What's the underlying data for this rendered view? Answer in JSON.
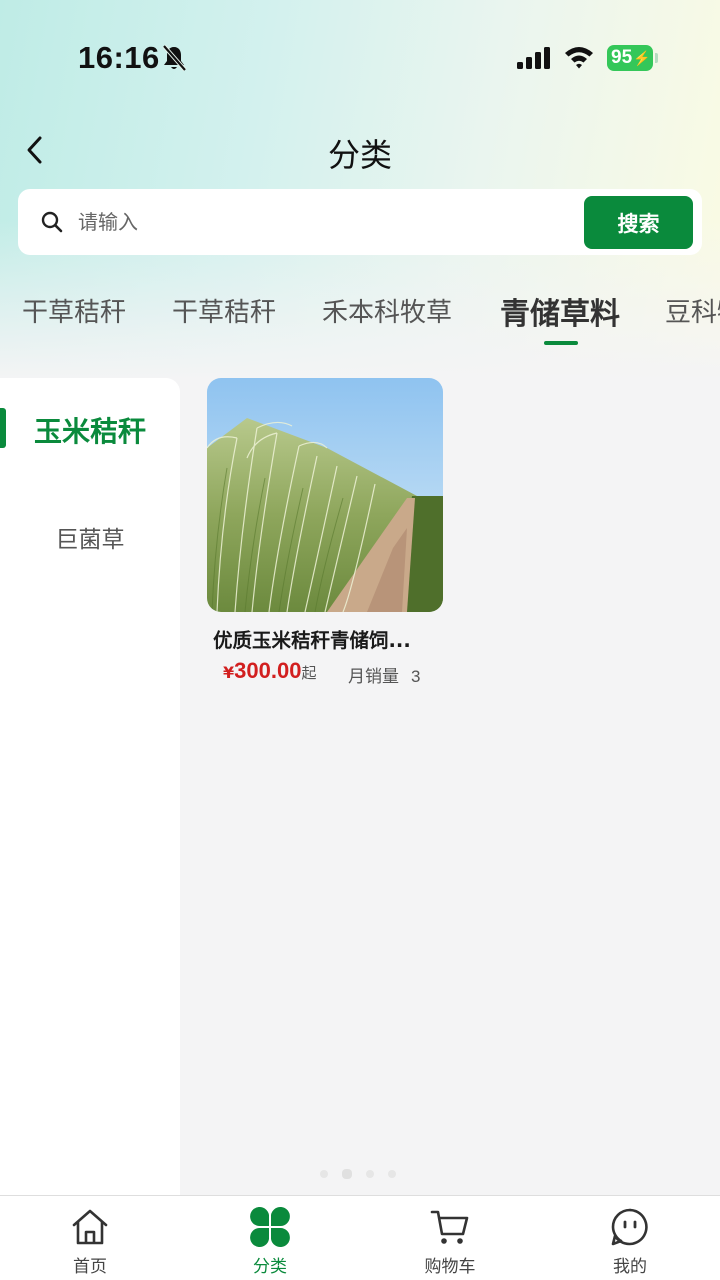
{
  "status_bar": {
    "time": "16:16",
    "battery": "95"
  },
  "header": {
    "title": "分类"
  },
  "search": {
    "placeholder": "请输入",
    "button_label": "搜索"
  },
  "category_tabs": [
    {
      "label": "干草秸秆",
      "active": false
    },
    {
      "label": "干草秸秆",
      "active": false
    },
    {
      "label": "禾本科牧草",
      "active": false
    },
    {
      "label": "青储草料",
      "active": true
    },
    {
      "label": "豆科牧草",
      "active": false
    }
  ],
  "sidebar": {
    "items": [
      {
        "label": "玉米秸秆",
        "active": true
      },
      {
        "label": "巨菌草",
        "active": false
      }
    ]
  },
  "products": [
    {
      "name": "优质玉米秸秆青储饲...",
      "price_symbol": "¥",
      "price": "300.00",
      "price_suffix": "起",
      "sales_label": "月销量",
      "sales_count": "3"
    }
  ],
  "tab_bar": {
    "items": [
      {
        "label": "首页",
        "icon": "home-icon",
        "active": false
      },
      {
        "label": "分类",
        "icon": "clover-icon",
        "active": true
      },
      {
        "label": "购物车",
        "icon": "cart-icon",
        "active": false
      },
      {
        "label": "我的",
        "icon": "profile-icon",
        "active": false
      }
    ]
  },
  "colors": {
    "accent": "#0a8a3c",
    "price": "#d21f1f",
    "background": "#f4f4f5"
  }
}
